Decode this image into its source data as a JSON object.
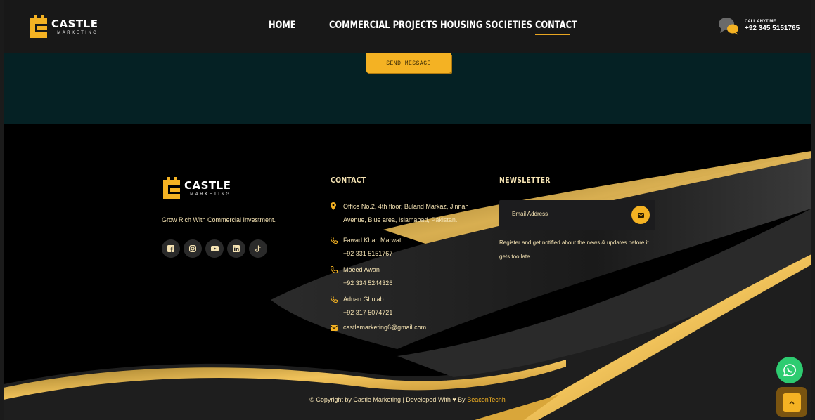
{
  "header": {
    "logo_text": "CASTLE",
    "logo_subtext": "MARKETING",
    "nav": [
      "HOME",
      "COMMERCIAL PROJECTS",
      "HOUSING SOCIETIES",
      "CONTACT"
    ],
    "active_nav": "CONTACT",
    "call_label": "CALL ANYTIME",
    "call_phone": "+92 345 5151765"
  },
  "contact_form": {
    "send_label": "SEND MESSAGE"
  },
  "footer": {
    "logo_text": "CASTLE",
    "logo_subtext": "MARKETING",
    "tagline": "Grow Rich With Commercial Investment.",
    "socials": [
      "facebook-icon",
      "instagram-icon",
      "youtube-icon",
      "linkedin-icon",
      "tiktok-icon"
    ],
    "contact": {
      "title": "CONTACT",
      "address": "Office No.2, 4th floor, Buland Markaz, Jinnah Avenue, Blue area, Islamabad, Pakistan.",
      "people": [
        {
          "name": "Fawad Khan Marwat",
          "phone": "+92 331 5151767"
        },
        {
          "name": "Moeed Awan",
          "phone": "+92 334 5244326"
        },
        {
          "name": "Adnan Ghulab",
          "phone": "+92 317 5074721"
        }
      ],
      "email": "castlemarketing6@gmail.com"
    },
    "newsletter": {
      "title": "NEWSLETTER",
      "placeholder": "Email Address",
      "note": "Register and get notified about the news & updates before it gets too late."
    },
    "copyright_prefix": "© Copyright by Castle Marketing | Developed With ♥ By",
    "developer": "BeaconTechh"
  },
  "colors": {
    "accent": "#f4b223",
    "teal": "#052124",
    "header_bg": "#181818",
    "text_cream": "#f5e3b3"
  }
}
